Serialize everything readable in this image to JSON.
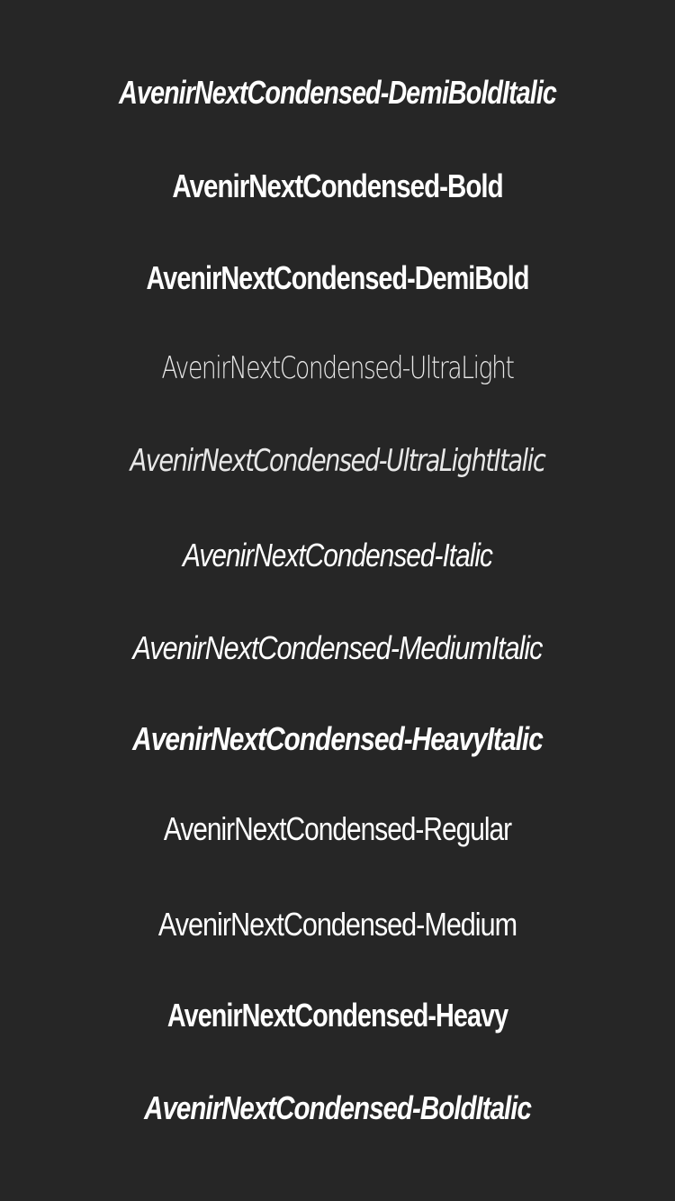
{
  "fonts": [
    {
      "label": "AvenirNextCondensed-DemiBoldItalic"
    },
    {
      "label": "AvenirNextCondensed-Bold"
    },
    {
      "label": "AvenirNextCondensed-DemiBold"
    },
    {
      "label": "AvenirNextCondensed-UltraLight"
    },
    {
      "label": "AvenirNextCondensed-UltraLightItalic"
    },
    {
      "label": "AvenirNextCondensed-Italic"
    },
    {
      "label": "AvenirNextCondensed-MediumItalic"
    },
    {
      "label": "AvenirNextCondensed-HeavyItalic"
    },
    {
      "label": "AvenirNextCondensed-Regular"
    },
    {
      "label": "AvenirNextCondensed-Medium"
    },
    {
      "label": "AvenirNextCondensed-Heavy"
    },
    {
      "label": "AvenirNextCondensed-BoldItalic"
    }
  ],
  "colors": {
    "background": "#262626",
    "text": "#ffffff"
  }
}
